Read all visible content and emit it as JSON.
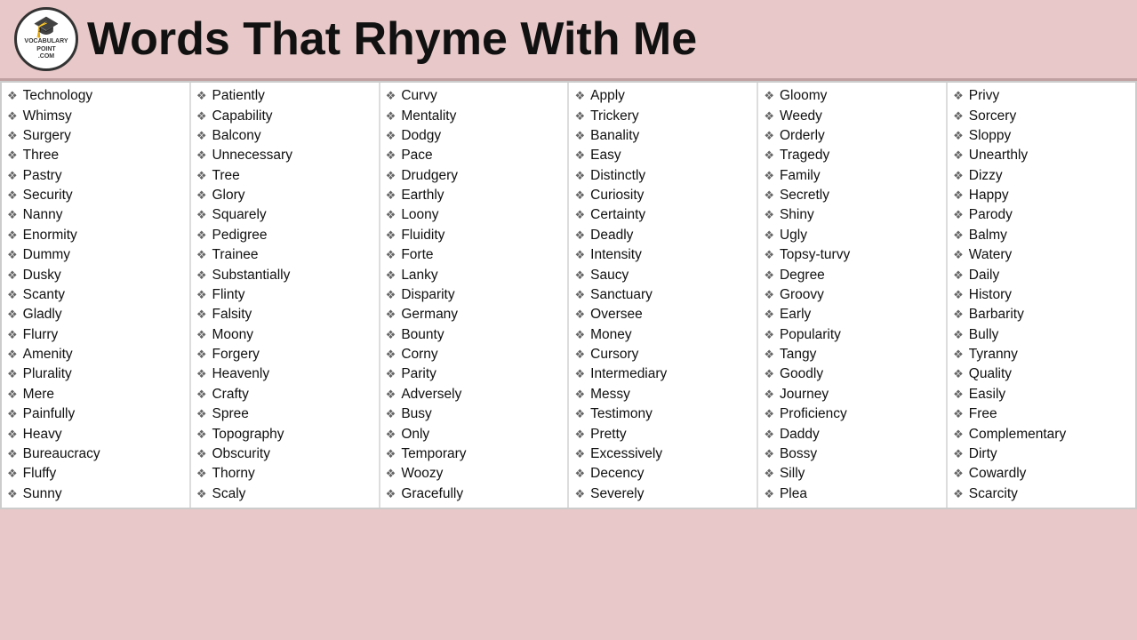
{
  "header": {
    "title": "Words That Rhyme With Me",
    "logo_line1": "VOCABULARY",
    "logo_line2": "POINT",
    "logo_line3": ".COM"
  },
  "columns": [
    {
      "words": [
        "Technology",
        "Whimsy",
        "Surgery",
        "Three",
        "Pastry",
        "Security",
        "Nanny",
        "Enormity",
        "Dummy",
        "Dusky",
        "Scanty",
        "Gladly",
        "Flurry",
        "Amenity",
        "Plurality",
        "Mere",
        "Painfully",
        "Heavy",
        "Bureaucracy",
        "Fluffy",
        "Sunny"
      ]
    },
    {
      "words": [
        "Patiently",
        "Capability",
        "Balcony",
        "Unnecessary",
        "Tree",
        "Glory",
        "Squarely",
        "Pedigree",
        "Trainee",
        "Substantially",
        "Flinty",
        "Falsity",
        "Moony",
        "Forgery",
        "Heavenly",
        "Crafty",
        "Spree",
        "Topography",
        "Obscurity",
        "Thorny",
        "Scaly"
      ]
    },
    {
      "words": [
        "Curvy",
        "Mentality",
        "Dodgy",
        "Pace",
        "Drudgery",
        "Earthly",
        "Loony",
        "Fluidity",
        "Forte",
        "Lanky",
        "Disparity",
        "Germany",
        "Bounty",
        "Corny",
        "Parity",
        "Adversely",
        "Busy",
        "Only",
        "Temporary",
        "Woozy",
        "Gracefully"
      ]
    },
    {
      "words": [
        "Apply",
        "Trickery",
        "Banality",
        "Easy",
        "Distinctly",
        "Curiosity",
        "Certainty",
        "Deadly",
        "Intensity",
        "Saucy",
        "Sanctuary",
        "Oversee",
        "Money",
        "Cursory",
        "Intermediary",
        "Messy",
        "Testimony",
        "Pretty",
        "Excessively",
        "Decency",
        "Severely"
      ]
    },
    {
      "words": [
        "Gloomy",
        "Weedy",
        "Orderly",
        "Tragedy",
        "Family",
        "Secretly",
        "Shiny",
        "Ugly",
        "Topsy-turvy",
        "Degree",
        "Groovy",
        "Early",
        "Popularity",
        "Tangy",
        "Goodly",
        "Journey",
        "Proficiency",
        "Daddy",
        "Bossy",
        "Silly",
        "Plea"
      ]
    },
    {
      "words": [
        "Privy",
        "Sorcery",
        "Sloppy",
        "Unearthly",
        "Dizzy",
        "Happy",
        "Parody",
        "Balmy",
        "Watery",
        "Daily",
        "History",
        "Barbarity",
        "Bully",
        "Tyranny",
        "Quality",
        "Easily",
        "Free",
        "Complementary",
        "Dirty",
        "Cowardly",
        "Scarcity"
      ]
    }
  ]
}
